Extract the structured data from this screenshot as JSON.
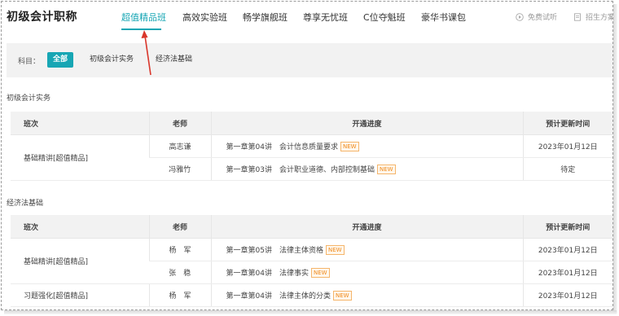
{
  "app": {
    "title": "初级会计职称"
  },
  "nav": {
    "tabs": [
      {
        "label": "超值精品班",
        "active": true
      },
      {
        "label": "高效实验班",
        "active": false
      },
      {
        "label": "畅学旗舰班",
        "active": false
      },
      {
        "label": "尊享无忧班",
        "active": false
      },
      {
        "label": "C位夺魁班",
        "active": false
      },
      {
        "label": "豪华书课包",
        "active": false
      }
    ],
    "free_trial": "免费试听",
    "enroll_plan": "招生方案"
  },
  "filter": {
    "label": "科目：",
    "options": [
      "全部",
      "初级会计实务",
      "经济法基础"
    ],
    "selected": "全部"
  },
  "columns": {
    "class": "班次",
    "teacher": "老师",
    "progress": "开通进度",
    "update_time": "预计更新时间"
  },
  "badge_new": "NEW",
  "sections": [
    {
      "title": "初级会计实务",
      "rows": [
        {
          "class": "基础精讲[超值精品]",
          "teacher": "高志谦",
          "progress": "第一章第04讲　会计信息质量要求",
          "is_new": true,
          "update_time": "2023年01月12日"
        },
        {
          "class": "",
          "teacher": "冯雅竹",
          "progress": "第一章第03讲　会计职业道德、内部控制基础",
          "is_new": true,
          "update_time": "待定"
        }
      ]
    },
    {
      "title": "经济法基础",
      "rows": [
        {
          "class": "基础精讲[超值精品]",
          "teacher": "杨　军",
          "progress": "第一章第05讲　法律主体资格",
          "is_new": true,
          "update_time": "2023年01月12日"
        },
        {
          "class": "",
          "teacher": "张　稳",
          "progress": "第一章第04讲　法律事实",
          "is_new": true,
          "update_time": "2023年01月12日"
        },
        {
          "class": "习题强化[超值精品]",
          "teacher": "杨　军",
          "progress": "第一章第04讲　法律主体的分类",
          "is_new": true,
          "update_time": "2023年01月12日"
        }
      ]
    }
  ],
  "colors": {
    "accent": "#17a6b4",
    "badge": "#f08a1c",
    "arrow": "#d9362b"
  }
}
